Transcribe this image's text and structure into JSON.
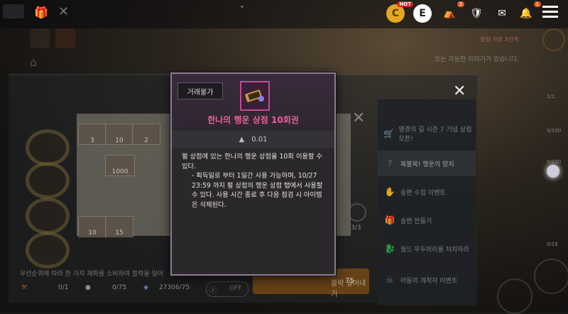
{
  "top": {
    "hot_badge": "HOT",
    "shop_badge": "3",
    "alert_badge": "1",
    "right_note_1": "일일 가로 3신게",
    "right_note_2": "오는 가능한 이야기가 있습니다."
  },
  "game": {
    "tiles": [
      {
        "label": "3"
      },
      {
        "label": "10"
      },
      {
        "label": "2"
      },
      {
        "label": "1000"
      },
      {
        "label": "10"
      },
      {
        "label": "15"
      }
    ],
    "progress_text": "3/3",
    "bottom_hint": "우선순위에 따라 한 가지 재화를 소비하여 블락을 일어",
    "res1": "0/1",
    "res2": "0/75",
    "res3": "27306/75",
    "toggle": "OFF",
    "cta_label": "블락 일어내기",
    "cta_count": "75"
  },
  "sidebar": {
    "items": [
      {
        "icon": "cart",
        "label": "명경의 길 시즌 7 기념 상점 오픈!",
        "selected": false
      },
      {
        "icon": "?",
        "label": "복불복! 행운의 망치",
        "selected": true
      },
      {
        "icon": "hand",
        "label": "숭편 수집 이벤트",
        "selected": false
      },
      {
        "icon": "gift",
        "label": "송편 만들기",
        "selected": false
      },
      {
        "icon": "dragon",
        "label": "월드 우두머리를 처치하라",
        "selected": false
      },
      {
        "icon": "skull",
        "label": "어둠의 개척자 이벤트",
        "selected": false
      }
    ],
    "counts": [
      "1/1",
      "0/100",
      "0/100",
      "0/15"
    ]
  },
  "tooltip": {
    "tag": "거래불가",
    "item_name": "한나의 행운 상점 10회권",
    "weight": "0.01",
    "desc_line1": "펄 상점에 있는 한나의 행운 상점을 10회 이용할 수 있다.",
    "desc_line2": "- 획득일로 부터 1일간 사용 가능하며, 10/27 23:59 까지 펄 상점의 행운 상점 탭에서 사용할 수 있다. 사용 시간 종료 후 다음 점검 시 아이템은 삭제된다.",
    "icon_accent": "#c14b95",
    "title_color": "#e8609f"
  }
}
